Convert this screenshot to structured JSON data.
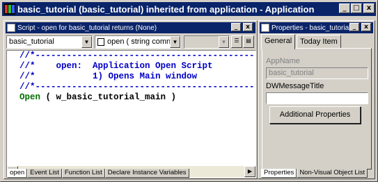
{
  "app": {
    "title": "basic_tutorial (basic_tutorial) inherited from application - Application",
    "minimize_glyph": "_",
    "restore_glyph": "□",
    "close_glyph": "x"
  },
  "script_window": {
    "title": "Script - open for basic_tutorial returns (None)",
    "object_combo": "basic_tutorial",
    "event_combo": "open ( string comn",
    "ancestor_combo": "",
    "code_lines": [
      {
        "text": "//*----------------------------------------------",
        "kind": "comment"
      },
      {
        "text": "//*    open:  Application Open Script",
        "kind": "comment"
      },
      {
        "text": "//*           1) Opens Main window",
        "kind": "comment"
      },
      {
        "text": "//*----------------------------------------------",
        "kind": "comment"
      },
      {
        "open": "Open",
        "rest": " ( w_basic_tutorial_main )",
        "kind": "statement"
      }
    ],
    "bottom_tabs": [
      "open",
      "Event List",
      "Function List",
      "Declare Instance Variables"
    ]
  },
  "properties_window": {
    "title": "Properties - basic_tutorial",
    "tabs": [
      "General",
      "Today Item"
    ],
    "appname_label": "AppName",
    "appname_value": "basic_tutorial",
    "dwmessagetitle_label": "DWMessageTitle",
    "dwmessagetitle_value": "",
    "additional_button": "Additional Properties",
    "bottom_tabs": [
      "Properties",
      "Non-Visual Object List"
    ]
  },
  "colors": {
    "titlebar": "#0a246a",
    "comment": "#0000c8",
    "keyword": "#007000",
    "face": "#d4d0c8"
  }
}
